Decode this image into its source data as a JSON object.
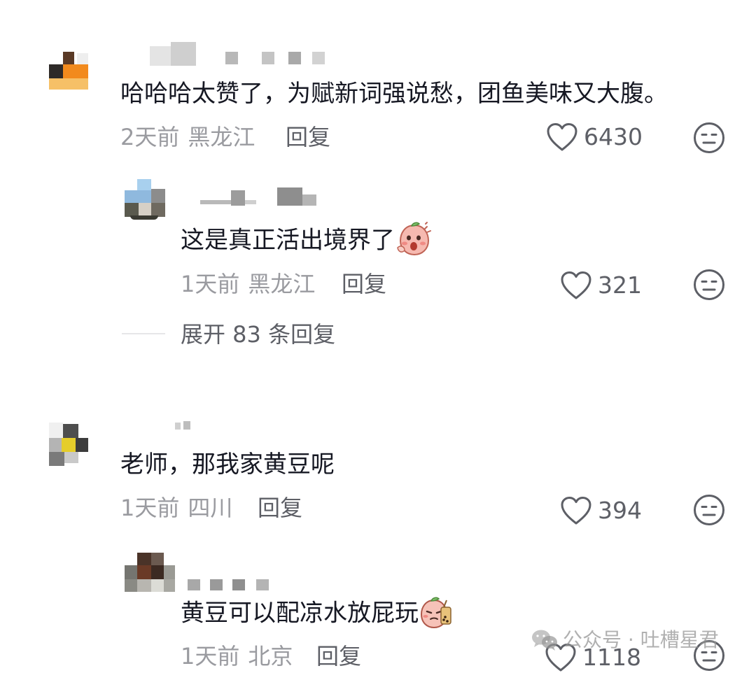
{
  "comments": [
    {
      "text": "哈哈哈太赞了，为赋新词强说愁，团鱼美味又大腹。",
      "time": "2天前",
      "location": "黑龙江",
      "reply_label": "回复",
      "likes": "6430",
      "replies": [
        {
          "text": "这是真正活出境界了",
          "emoji": "blushing-peach-sticker",
          "time": "1天前",
          "location": "黑龙江",
          "reply_label": "回复",
          "likes": "321"
        }
      ],
      "expand_label": "展开 83 条回复"
    },
    {
      "text": "老师，那我家黄豆呢",
      "time": "1天前",
      "location": "四川",
      "reply_label": "回复",
      "likes": "394",
      "replies": [
        {
          "text": "黄豆可以配凉水放屁玩",
          "emoji": "peach-bubble-tea-sticker",
          "time": "1天前",
          "location": "北京",
          "reply_label": "回复",
          "likes": "1118"
        }
      ]
    }
  ],
  "watermark": {
    "icon": "wechat-icon",
    "text": "公众号 · 吐槽星君"
  },
  "colors": {
    "text": "#161823",
    "meta": "#9a9ba0",
    "action": "#5d5f66",
    "divider": "#e6e6e8"
  }
}
